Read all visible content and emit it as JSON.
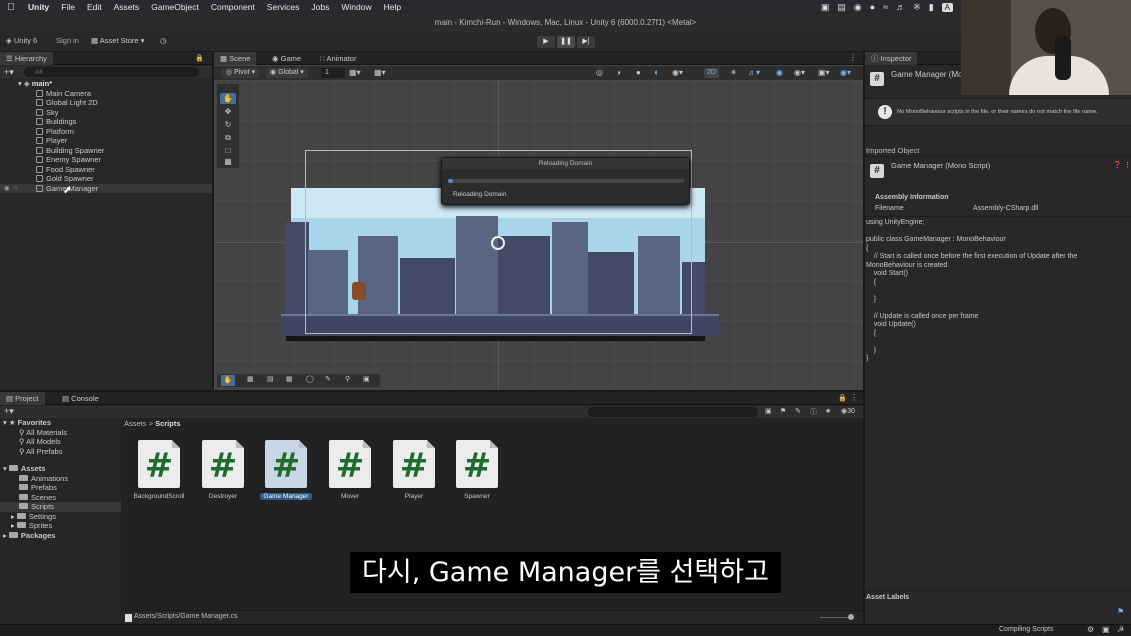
{
  "menubar": {
    "app": "Unity",
    "items": [
      "File",
      "Edit",
      "Assets",
      "GameObject",
      "Component",
      "Services",
      "Jobs",
      "Window",
      "Help"
    ],
    "tray_badge": "A"
  },
  "titlebar": {
    "title": "main - Kimchi-Run - Windows, Mac, Linux - Unity 6 (6000.0.27f1) <Metal>"
  },
  "toolbar": {
    "account": "Unity 6",
    "signin": "Sign in",
    "asset_store": "Asset Store"
  },
  "hierarchy": {
    "tab": "Hierarchy",
    "search_placeholder": "All",
    "scene": "main*",
    "items": [
      "Main Camera",
      "Global Light 2D",
      "Sky",
      "Buildings",
      "Platform",
      "Player",
      "Building Spawner",
      "Enemy Spawner",
      "Food Spawner",
      "Gold Spawner",
      "Game Manager"
    ]
  },
  "scene": {
    "tabs": [
      "Scene",
      "Game",
      "Animator"
    ],
    "pivot": "Pivot",
    "global": "Global",
    "snap": "1",
    "mode_2d": "2D"
  },
  "modal": {
    "title": "Reloading Domain",
    "message": "Reloading Domain",
    "progress": 0.02
  },
  "inspector": {
    "tab": "Inspector",
    "object": "Game Manager (Mo",
    "warning": "No MonoBehaviour scripts in the file, or their names do not match the file name.",
    "imported": "Imported Object",
    "script_name": "Game Manager (Mono Script)",
    "assembly_header": "Assembly Information",
    "filename_label": "Filename",
    "filename_value": "Assembly-CSharp.dll",
    "code": [
      "using UnityEngine;",
      "",
      "public class GameManager : MonoBehaviour",
      "{",
      "    // Start is called once before the first execution of Update after the",
      "MonoBehaviour is created",
      "    void Start()",
      "    {",
      "",
      "    }",
      "",
      "    // Update is called once per frame",
      "    void Update()",
      "    {",
      "",
      "    }",
      "}"
    ],
    "asset_labels": "Asset Labels"
  },
  "project": {
    "tabs": [
      "Project",
      "Console"
    ],
    "count": "30",
    "favorites": "Favorites",
    "favorite_items": [
      "All Materials",
      "All Models",
      "All Prefabs"
    ],
    "assets": "Assets",
    "asset_folders": [
      "Animations",
      "Prefabs",
      "Scenes",
      "Scripts",
      "Settings",
      "Sprites"
    ],
    "packages": "Packages",
    "breadcrumb_root": "Assets",
    "breadcrumb_sep": ">",
    "breadcrumb_current": "Scripts",
    "files": [
      "BackgroundScroll",
      "Destroyer",
      "Game Manager",
      "Mover",
      "Player",
      "Spawner"
    ],
    "selected_file": "Game Manager",
    "path": "Assets/Scripts/Game Manager.cs"
  },
  "status": {
    "text": "Compiling Scripts"
  },
  "subtitle": "다시, Game Manager를 선택하고"
}
